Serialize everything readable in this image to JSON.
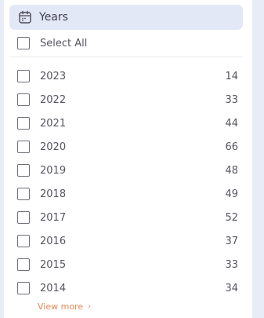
{
  "filter": {
    "title": "Years",
    "select_all_label": "Select All",
    "items": [
      {
        "year": "2023",
        "count": "14"
      },
      {
        "year": "2022",
        "count": "33"
      },
      {
        "year": "2021",
        "count": "44"
      },
      {
        "year": "2020",
        "count": "66"
      },
      {
        "year": "2019",
        "count": "48"
      },
      {
        "year": "2018",
        "count": "49"
      },
      {
        "year": "2017",
        "count": "52"
      },
      {
        "year": "2016",
        "count": "37"
      },
      {
        "year": "2015",
        "count": "33"
      },
      {
        "year": "2014",
        "count": "34"
      }
    ],
    "view_more_label": "View more",
    "view_more_chevron": "›"
  },
  "colors": {
    "header_bg": "#e3e8f6",
    "page_bg": "#e8ecf6",
    "link": "#e08a54"
  }
}
